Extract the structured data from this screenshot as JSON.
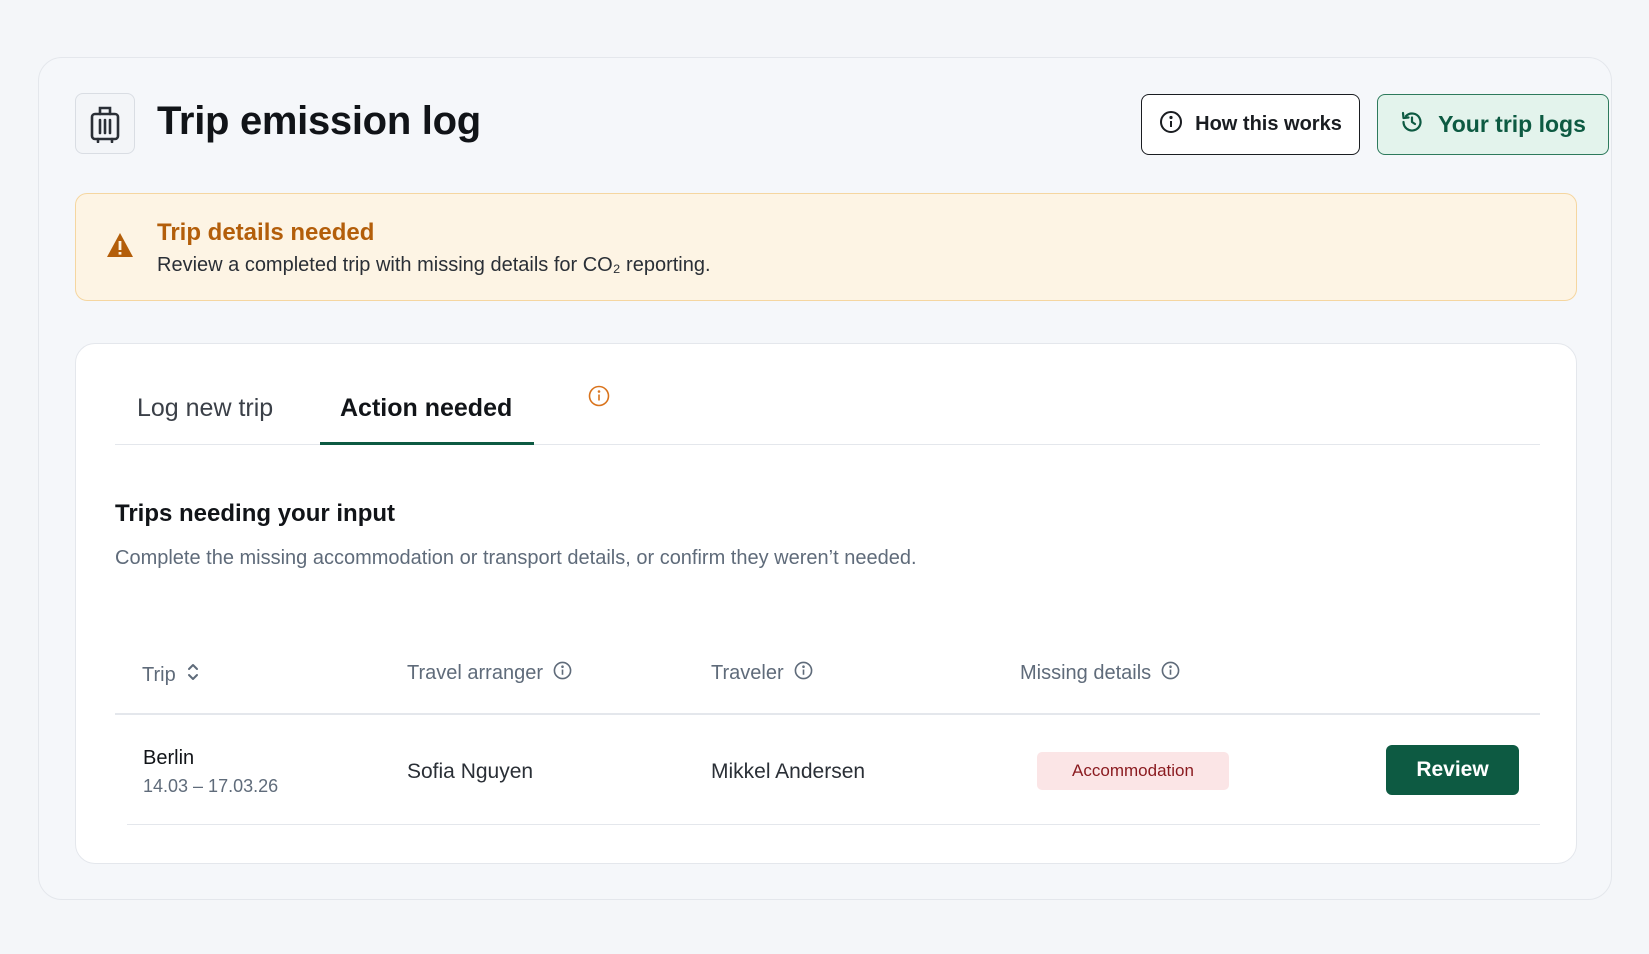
{
  "header": {
    "title": "Trip emission log",
    "app_icon": "suitcase-icon",
    "how_button": {
      "label": "How this works",
      "icon": "info-circle-icon"
    },
    "logs_button": {
      "label": "Your trip logs",
      "icon": "history-icon"
    }
  },
  "alert": {
    "icon": "warning-triangle-icon",
    "title": "Trip details needed",
    "text": "Review a completed trip with missing details for CO₂ reporting.",
    "color": "#b35e0a",
    "background": "#fdf4e4"
  },
  "tabs": [
    {
      "label": "Log new trip",
      "active": false
    },
    {
      "label": "Action needed",
      "active": true,
      "icon": "info-circle-icon"
    }
  ],
  "section": {
    "title": "Trips needing your input",
    "description": "Complete the missing accommodation or transport details, or confirm they weren’t needed."
  },
  "table": {
    "columns": [
      {
        "label": "Trip",
        "icon": "sort-icon"
      },
      {
        "label": "Travel arranger",
        "icon": "info-circle-icon"
      },
      {
        "label": "Traveler",
        "icon": "info-circle-icon"
      },
      {
        "label": "Missing details",
        "icon": "info-circle-icon"
      }
    ],
    "rows": [
      {
        "trip": "Berlin",
        "dates": "14.03 – 17.03.26",
        "arranger": "Sofia Nguyen",
        "traveler": "Mikkel Andersen",
        "missing": "Accommodation",
        "action": "Review"
      }
    ]
  },
  "colors": {
    "accent": "#0d5a42",
    "accent_light": "#e3f3ec",
    "badge_bg": "#fbe5e6",
    "badge_text": "#8a1a1f"
  }
}
